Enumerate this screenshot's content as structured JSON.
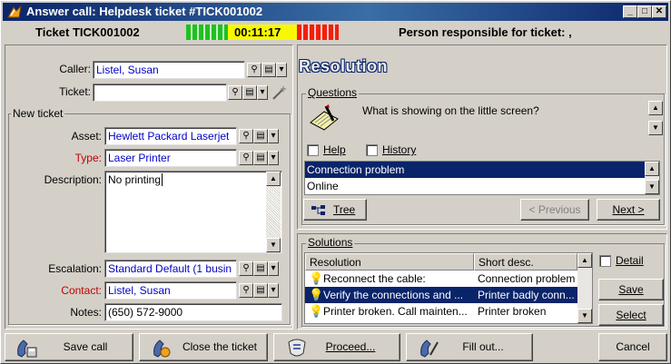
{
  "window": {
    "title": "Answer call: Helpdesk ticket #TICK001002",
    "minimize": "_",
    "maximize": "□",
    "close": "✕"
  },
  "header": {
    "ticket": "Ticket TICK001002",
    "timer": "00:11:17",
    "person_responsible": "Person responsible for ticket: ,"
  },
  "left": {
    "caller_label": "Caller:",
    "caller_value": "Listel, Susan",
    "ticket_label": "Ticket:",
    "ticket_value": "",
    "new_ticket_group": "New ticket",
    "asset_label": "Asset:",
    "asset_value": "Hewlett Packard Laserjet",
    "type_label": "Type:",
    "type_value": "Laser Printer",
    "description_label": "Description:",
    "description_value": "No printing",
    "escalation_label": "Escalation:",
    "escalation_value": "Standard Default (1 busin",
    "contact_label": "Contact:",
    "contact_value": "Listel, Susan",
    "notes_label": "Notes:",
    "notes_value": "(650) 572-9000"
  },
  "right": {
    "resolution_title": "Resolution",
    "questions_group": "Questions",
    "question_text": "What is showing on the little screen?",
    "help_label": "Help",
    "history_label": "History",
    "answers": [
      "Connection problem",
      "Online"
    ],
    "tree_button": "Tree",
    "previous_button": "< Previous",
    "next_button": "Next >",
    "solutions_group": "Solutions",
    "sol_col1": "Resolution",
    "sol_col2": "Short desc.",
    "solutions": [
      {
        "res": "Reconnect the cable:",
        "desc": "Connection problem"
      },
      {
        "res": "Verify the connections and ...",
        "desc": "Printer badly conn..."
      },
      {
        "res": "Printer broken. Call mainten...",
        "desc": "Printer broken"
      }
    ],
    "detail_label": "Detail",
    "save_button": "Save",
    "select_button": "Select"
  },
  "bottom": {
    "save_call": "Save call",
    "close_ticket": "Close the ticket",
    "proceed": "Proceed...",
    "fill_out": "Fill out...",
    "cancel": "Cancel"
  }
}
